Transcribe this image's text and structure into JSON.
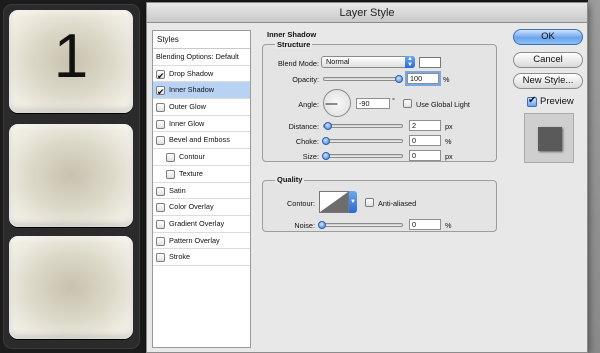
{
  "canvas": {
    "tiles": [
      {
        "label": "1"
      },
      {
        "label": ""
      },
      {
        "label": ""
      }
    ]
  },
  "dialog": {
    "title": "Layer Style",
    "styles_header": "Styles",
    "styles": [
      {
        "label": "Blending Options: Default",
        "checkbox": false,
        "checked": false,
        "indent": 0,
        "selected": false
      },
      {
        "label": "Drop Shadow",
        "checkbox": true,
        "checked": true,
        "indent": 0,
        "selected": false
      },
      {
        "label": "Inner Shadow",
        "checkbox": true,
        "checked": true,
        "indent": 0,
        "selected": true
      },
      {
        "label": "Outer Glow",
        "checkbox": true,
        "checked": false,
        "indent": 0,
        "selected": false
      },
      {
        "label": "Inner Glow",
        "checkbox": true,
        "checked": false,
        "indent": 0,
        "selected": false
      },
      {
        "label": "Bevel and Emboss",
        "checkbox": true,
        "checked": false,
        "indent": 0,
        "selected": false
      },
      {
        "label": "Contour",
        "checkbox": true,
        "checked": false,
        "indent": 1,
        "selected": false
      },
      {
        "label": "Texture",
        "checkbox": true,
        "checked": false,
        "indent": 1,
        "selected": false
      },
      {
        "label": "Satin",
        "checkbox": true,
        "checked": false,
        "indent": 0,
        "selected": false
      },
      {
        "label": "Color Overlay",
        "checkbox": true,
        "checked": false,
        "indent": 0,
        "selected": false
      },
      {
        "label": "Gradient Overlay",
        "checkbox": true,
        "checked": false,
        "indent": 0,
        "selected": false
      },
      {
        "label": "Pattern Overlay",
        "checkbox": true,
        "checked": false,
        "indent": 0,
        "selected": false
      },
      {
        "label": "Stroke",
        "checkbox": true,
        "checked": false,
        "indent": 0,
        "selected": false
      }
    ],
    "inner_shadow": {
      "section_title": "Inner Shadow",
      "structure": {
        "title": "Structure",
        "blend_mode_label": "Blend Mode:",
        "blend_mode_value": "Normal",
        "opacity_label": "Opacity:",
        "opacity_value": "100",
        "opacity_unit": "%",
        "opacity_fraction": 1.0,
        "angle_label": "Angle:",
        "angle_value": "-90",
        "angle_unit": "°",
        "use_global_light_label": "Use Global Light",
        "distance_label": "Distance:",
        "distance_value": "2",
        "distance_unit": "px",
        "choke_label": "Choke:",
        "choke_value": "0",
        "choke_unit": "%",
        "size_label": "Size:",
        "size_value": "0",
        "size_unit": "px"
      },
      "quality": {
        "title": "Quality",
        "contour_label": "Contour:",
        "anti_aliased_label": "Anti-aliased",
        "noise_label": "Noise:",
        "noise_value": "0",
        "noise_unit": "%"
      }
    },
    "buttons": {
      "ok": "OK",
      "cancel": "Cancel",
      "new_style": "New Style...",
      "preview": "Preview"
    },
    "colors": {
      "accent": "#6aa4ee",
      "selected_row": "#b7d2f3"
    }
  }
}
